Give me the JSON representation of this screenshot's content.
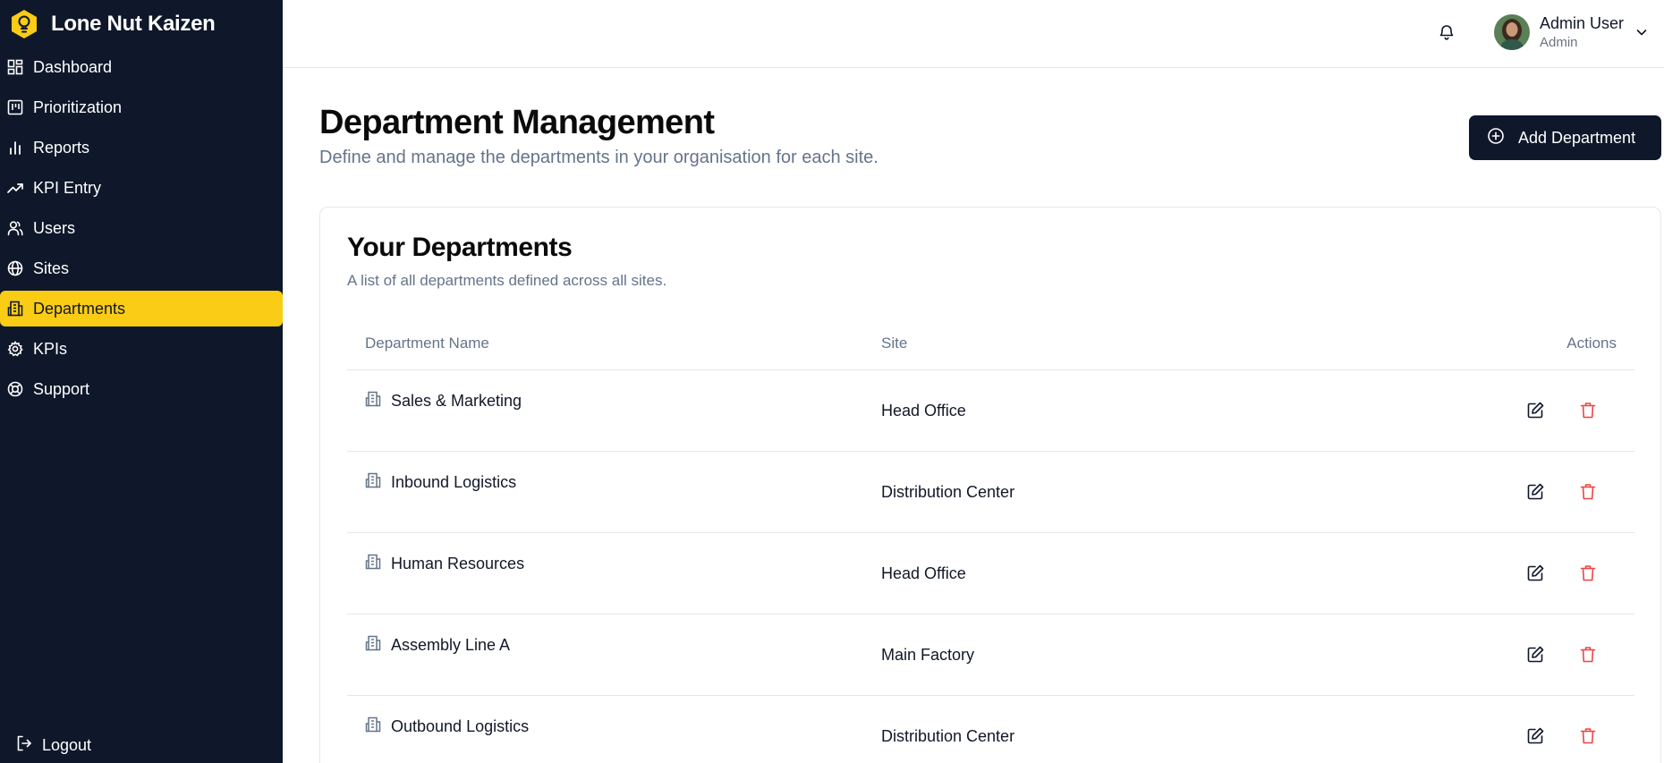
{
  "app": {
    "title": "Lone Nut Kaizen",
    "logo_icon": "lightbulb-icon",
    "brand_color": "#facc15",
    "sidebar_bg": "#0f172a"
  },
  "sidebar": {
    "items": [
      {
        "label": "Dashboard",
        "icon": "dashboard-icon"
      },
      {
        "label": "Prioritization",
        "icon": "kanban-icon"
      },
      {
        "label": "Reports",
        "icon": "bar-chart-icon"
      },
      {
        "label": "KPI Entry",
        "icon": "trending-up-icon"
      },
      {
        "label": "Users",
        "icon": "users-icon"
      },
      {
        "label": "Sites",
        "icon": "globe-icon"
      },
      {
        "label": "Departments",
        "icon": "building-icon",
        "active": true
      },
      {
        "label": "KPIs",
        "icon": "gear-icon"
      },
      {
        "label": "Support",
        "icon": "lifebuoy-icon"
      }
    ],
    "logout_label": "Logout"
  },
  "header": {
    "notification_icon": "bell-icon",
    "user": {
      "name": "Admin User",
      "role": "Admin"
    }
  },
  "page": {
    "title": "Department Management",
    "subtitle": "Define and manage the departments in your organisation for each site.",
    "add_button_label": "Add Department"
  },
  "card": {
    "title": "Your Departments",
    "subtitle": "A list of all departments defined across all sites.",
    "columns": {
      "name": "Department Name",
      "site": "Site",
      "actions": "Actions"
    },
    "rows": [
      {
        "name": "Sales & Marketing",
        "site": "Head Office"
      },
      {
        "name": "Inbound Logistics",
        "site": "Distribution Center"
      },
      {
        "name": "Human Resources",
        "site": "Head Office"
      },
      {
        "name": "Assembly Line A",
        "site": "Main Factory"
      },
      {
        "name": "Outbound Logistics",
        "site": "Distribution Center"
      }
    ]
  }
}
